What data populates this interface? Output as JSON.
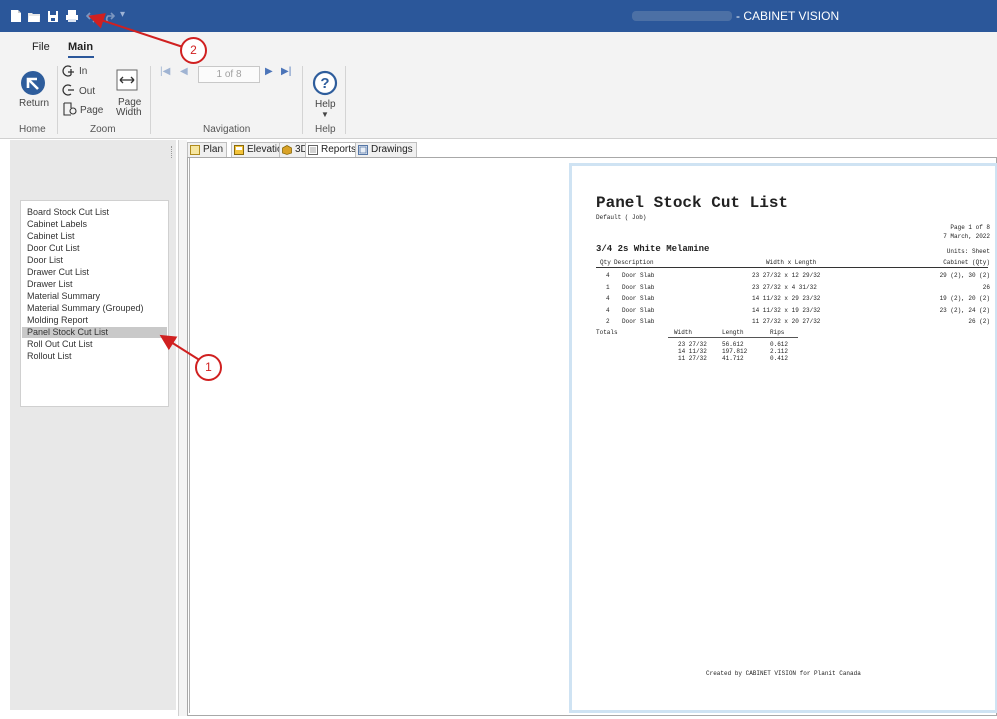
{
  "app": {
    "title_suffix": "- CABINET VISION"
  },
  "menu": {
    "file": "File",
    "main": "Main"
  },
  "ribbon": {
    "return_label": "Return",
    "zoom_in": "In",
    "zoom_out": "Out",
    "zoom_page": "Page",
    "page_width_1": "Page",
    "page_width_2": "Width",
    "pager_text": "1 of 8",
    "help_label": "Help",
    "groups": {
      "home": "Home",
      "zoom": "Zoom",
      "navigation": "Navigation",
      "help": "Help"
    }
  },
  "tabs": [
    "Plan",
    "Elevation",
    "3D",
    "Reports",
    "Drawings"
  ],
  "reports_list": [
    "Board Stock Cut List",
    "Cabinet Labels",
    "Cabinet List",
    "Door Cut List",
    "Door List",
    "Drawer Cut List",
    "Drawer List",
    "Material Summary",
    "Material Summary (Grouped)",
    "Molding Report",
    "Panel Stock Cut List",
    "Roll Out Cut List",
    "Rollout List"
  ],
  "selected_report": "Panel Stock Cut List",
  "report": {
    "title": "Panel Stock Cut List",
    "subtitle": "Default ( Job)",
    "page": "Page 1 of 8",
    "date": "7 March, 2022",
    "material": "3/4 2s White Melamine",
    "units": "Units: Sheet",
    "headers": {
      "qty": "Qty",
      "description": "Description",
      "size": "Width x Length",
      "cabinet": "Cabinet (Qty)"
    },
    "rows": [
      {
        "qty": "4",
        "desc": "Door Slab",
        "size": "23 27/32 x 12 29/32",
        "cab": "29 (2), 30 (2)"
      },
      {
        "qty": "1",
        "desc": "Door Slab",
        "size": "23 27/32 x 4 31/32",
        "cab": "26"
      },
      {
        "qty": "4",
        "desc": "Door Slab",
        "size": "14 11/32 x 29 23/32",
        "cab": "19 (2), 20 (2)"
      },
      {
        "qty": "4",
        "desc": "Door Slab",
        "size": "14 11/32 x 19 23/32",
        "cab": "23 (2), 24 (2)"
      },
      {
        "qty": "2",
        "desc": "Door Slab",
        "size": "11 27/32 x 20 27/32",
        "cab": "26 (2)"
      }
    ],
    "totals_label": "Totals",
    "totals_headers": {
      "width": "Width",
      "length": "Length",
      "rips": "Rips"
    },
    "totals_rows": [
      {
        "width": "23 27/32",
        "length": "56.612",
        "rips": "0.612"
      },
      {
        "width": "14 11/32",
        "length": "197.812",
        "rips": "2.112"
      },
      {
        "width": "11 27/32",
        "length": "41.712",
        "rips": "0.412"
      }
    ],
    "footer": "Created by CABINET VISION for Planit Canada"
  },
  "annotations": [
    "1",
    "2"
  ],
  "colors": {
    "titlebar": "#2b579a",
    "annotation": "#d02020",
    "selection": "#c9c9c9"
  }
}
